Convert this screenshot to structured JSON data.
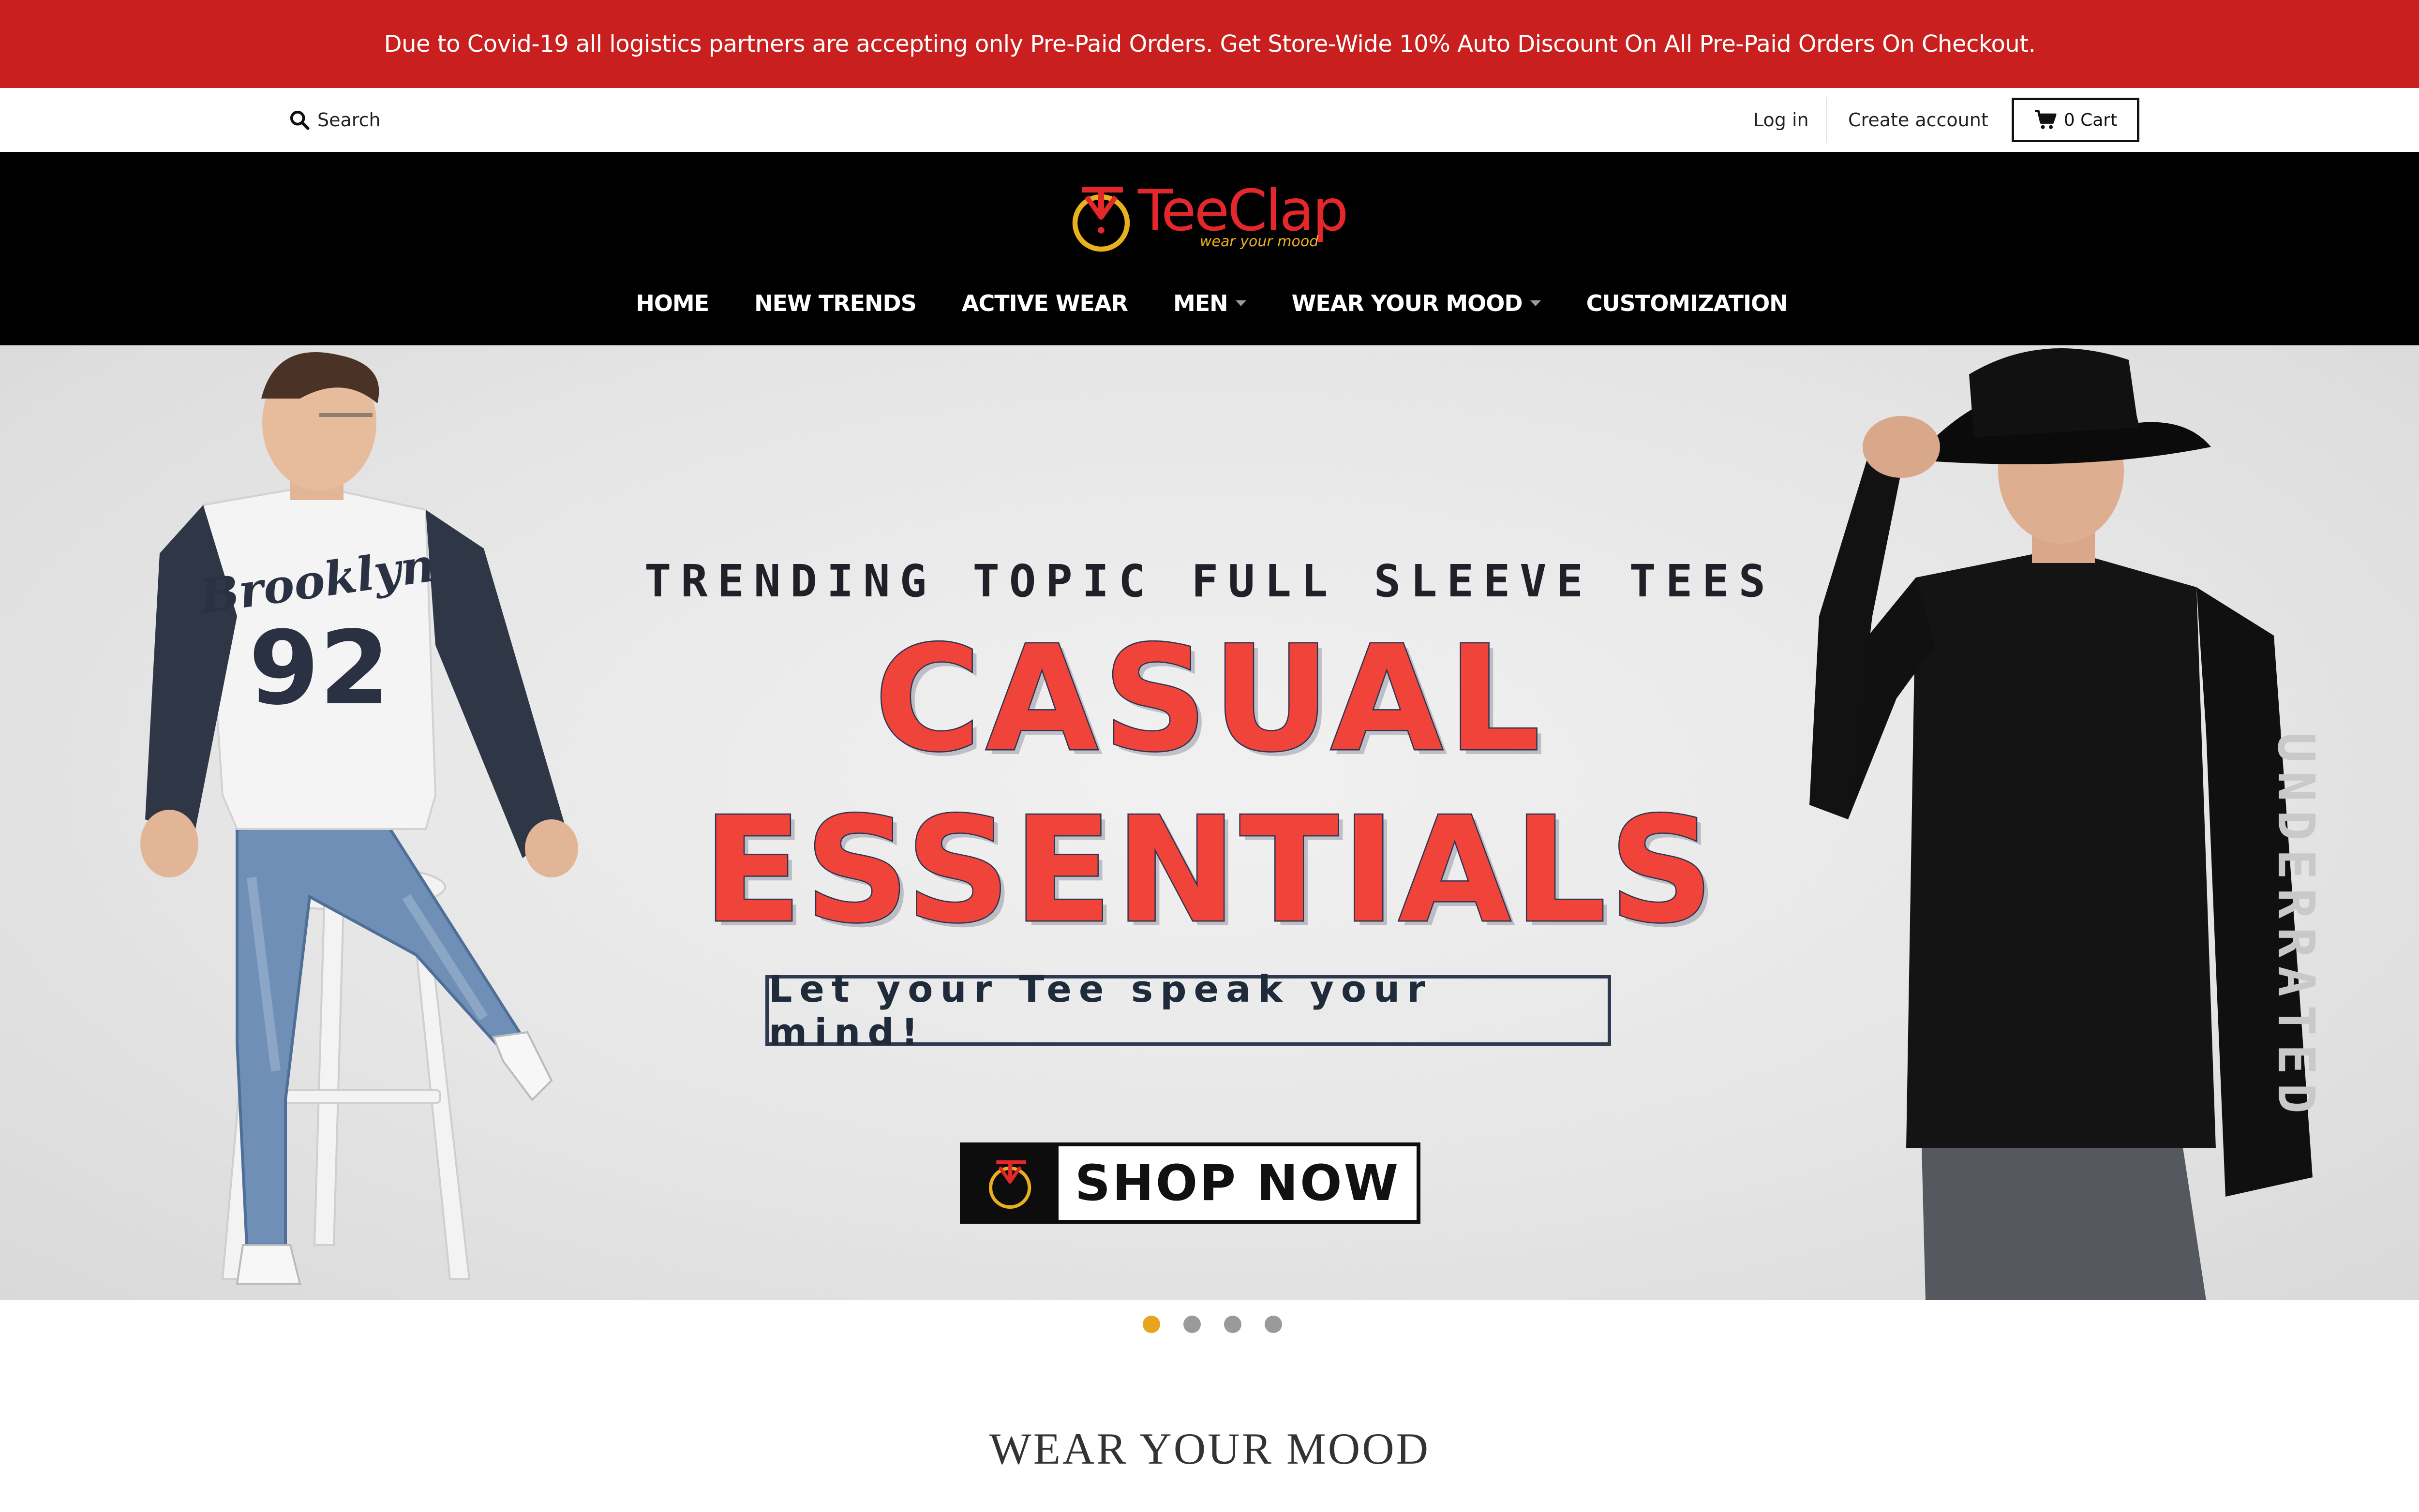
{
  "announcement": {
    "text": "Due to Covid-19 all logistics partners are accepting only Pre-Paid Orders. Get Store-Wide 10% Auto Discount On All Pre-Paid Orders On Checkout."
  },
  "utility": {
    "search_label": "Search",
    "login_label": "Log in",
    "create_account_label": "Create account",
    "cart_label": "0 Cart"
  },
  "brand": {
    "name": "TeeClap",
    "tagline": "wear your mood",
    "colors": {
      "red": "#e3272b",
      "gold": "#e8b01f"
    }
  },
  "nav": {
    "items": [
      {
        "label": "HOME",
        "dropdown": false
      },
      {
        "label": "NEW TRENDS",
        "dropdown": false
      },
      {
        "label": "ACTIVE WEAR",
        "dropdown": false
      },
      {
        "label": "MEN",
        "dropdown": true
      },
      {
        "label": "WEAR YOUR MOOD",
        "dropdown": true
      },
      {
        "label": "CUSTOMIZATION",
        "dropdown": false
      }
    ]
  },
  "hero": {
    "eyebrow": "TRENDING TOPIC FULL SLEEVE TEES",
    "line1": "CASUAL",
    "line2": "ESSENTIALS",
    "tagline": "Let your Tee speak your mind!",
    "cta_label": "SHOP NOW",
    "left_shirt_text": "Brooklyn",
    "left_shirt_number": "92",
    "right_sleeve_text": "UNDERRATED",
    "accent_color": "#f0443a",
    "stroke_color": "#2e3450"
  },
  "slider": {
    "slide_count": 4,
    "active_index": 0,
    "active_color": "#e8a31f",
    "inactive_color": "#9a9a9a"
  },
  "section": {
    "title": "WEAR YOUR MOOD"
  }
}
